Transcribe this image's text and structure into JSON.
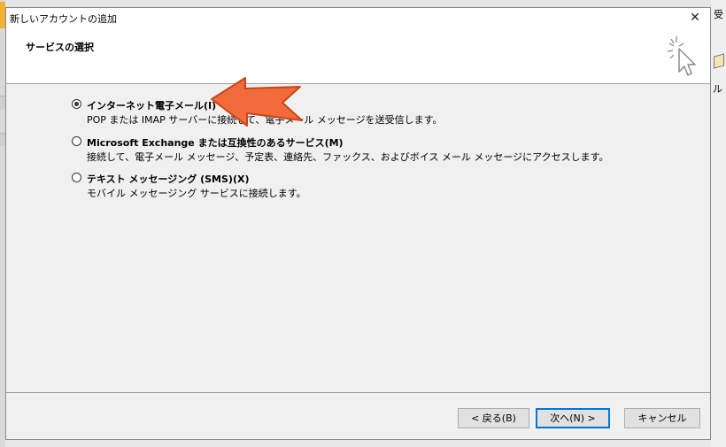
{
  "background": {
    "right_top_text": "受",
    "right_mid_text": "ル"
  },
  "dialog": {
    "title": "新しいアカウントの追加",
    "close_glyph": "✕",
    "header_title": "サービスの選択",
    "options": [
      {
        "label": "インターネット電子メール(I)",
        "description": "POP または IMAP サーバーに接続して、電子メール メッセージを送受信します。",
        "selected": true
      },
      {
        "label": "Microsoft Exchange または互換性のあるサービス(M)",
        "description": "接続して、電子メール メッセージ、予定表、連絡先、ファックス、およびボイス メール メッセージにアクセスします。",
        "selected": false
      },
      {
        "label": "テキスト メッセージング (SMS)(X)",
        "description": "モバイル メッセージング サービスに接続します。",
        "selected": false
      }
    ],
    "buttons": {
      "back": "< 戻る(B)",
      "next": "次へ(N) >",
      "cancel": "キャンセル"
    }
  },
  "annotation": {
    "arrow_color": "#f26b3a",
    "icon": "pointing-arrow-icon"
  }
}
